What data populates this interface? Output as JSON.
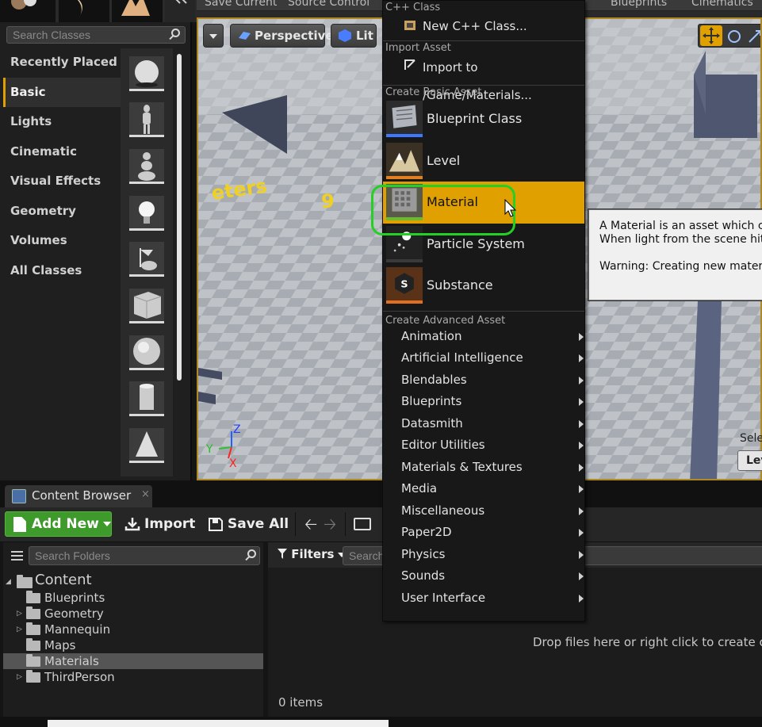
{
  "window_toolbar": {
    "save_current": "Save Current",
    "source_control": "Source Control",
    "blueprints": "Blueprints",
    "cinematics": "Cinematics"
  },
  "place_panel": {
    "search_placeholder": "Search Classes",
    "categories": [
      "Recently Placed",
      "Basic",
      "Lights",
      "Cinematic",
      "Visual Effects",
      "Geometry",
      "Volumes",
      "All Classes"
    ],
    "active_category": "Basic",
    "thumbnails": [
      "sphere-thumb",
      "mannequin-thumb",
      "pawn-thumb",
      "light-bulb-thumb",
      "game-mode-thumb",
      "cube-thumb",
      "sphere-thumb",
      "cylinder-thumb",
      "cone-thumb"
    ]
  },
  "viewport": {
    "perspective_label": "Perspective",
    "lit_label": "Lit",
    "floor_text": "eters",
    "floor_number": "9",
    "axis_z": "Z",
    "axis_y": "Y",
    "axis_x": "X",
    "selection_label": "Sele",
    "level_button": "Lev"
  },
  "tooltip": {
    "line1": "A Material is an asset which c",
    "line2": "When light from the scene hits",
    "warning": "Warning: Creating new materi"
  },
  "add_new_menu": {
    "section_cpp": "C++ Class",
    "new_cpp_class": "New C++ Class...",
    "section_import": "Import Asset",
    "import_to": "Import to /Game/Materials...",
    "section_basic": "Create Basic Asset",
    "basic_assets": [
      "Blueprint Class",
      "Level",
      "Material",
      "Particle System",
      "Substance"
    ],
    "highlighted_asset": "Material",
    "section_advanced": "Create Advanced Asset",
    "advanced_assets": [
      "Animation",
      "Artificial Intelligence",
      "Blendables",
      "Blueprints",
      "Datasmith",
      "Editor Utilities",
      "Materials & Textures",
      "Media",
      "Miscellaneous",
      "Paper2D",
      "Physics",
      "Sounds",
      "User Interface"
    ]
  },
  "content_browser": {
    "tab_label": "Content Browser",
    "tab_close": "×",
    "add_new_label": "Add New",
    "import_label": "Import",
    "save_all_label": "Save All",
    "search_folders_placeholder": "Search Folders",
    "filters_label": "Filters",
    "search_assets_placeholder": "Search",
    "root_folder": "Content",
    "folders": [
      "Blueprints",
      "Geometry",
      "Mannequin",
      "Maps",
      "Materials",
      "ThirdPerson"
    ],
    "selected_folder": "Materials",
    "drop_hint": "Drop files here or right click to create cont",
    "item_count": "0 items"
  },
  "colors": {
    "accent": "#e0a000",
    "add_new_green": "#3f9a2c",
    "highlight_ring": "#24d024"
  }
}
